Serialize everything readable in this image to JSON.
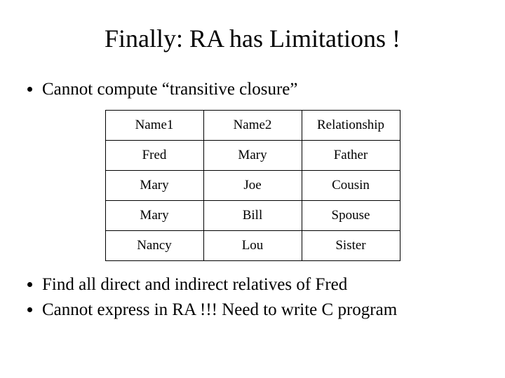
{
  "title": "Finally: RA has Limitations !",
  "bullets_top": [
    "Cannot compute “transitive closure”"
  ],
  "table": {
    "headers": [
      "Name1",
      "Name2",
      "Relationship"
    ],
    "rows": [
      [
        "Fred",
        "Mary",
        "Father"
      ],
      [
        "Mary",
        "Joe",
        "Cousin"
      ],
      [
        "Mary",
        "Bill",
        "Spouse"
      ],
      [
        "Nancy",
        "Lou",
        "Sister"
      ]
    ]
  },
  "bullets_bottom": [
    "Find all direct and indirect relatives of Fred",
    "Cannot express in RA !!!  Need to write C program"
  ]
}
